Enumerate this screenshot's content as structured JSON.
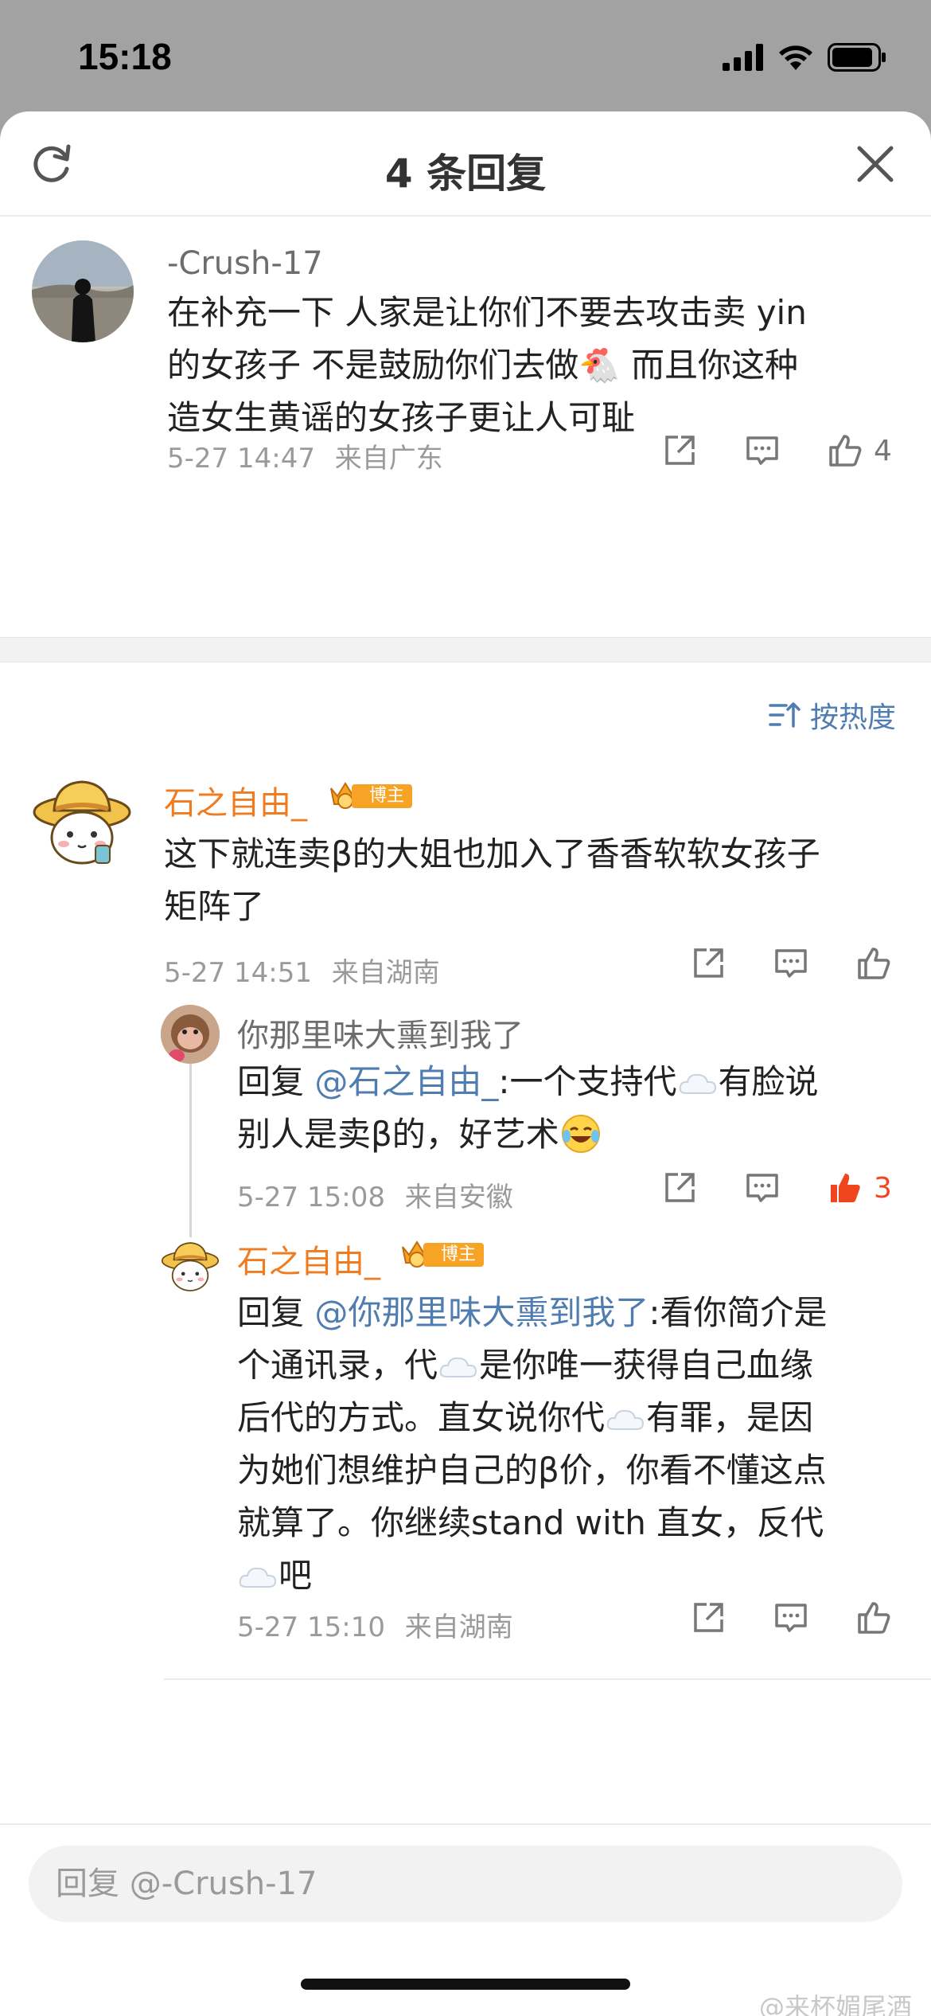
{
  "status_bar": {
    "time": "15:18"
  },
  "header": {
    "title": "4 条回复"
  },
  "root_comment": {
    "username": "-Crush-17",
    "text_line1": "在补充一下 人家是让你们不要去攻击卖 yin",
    "text_line2a": "的女孩子 不是鼓励你们去做",
    "text_line2b": " 而且你这种",
    "text_line3": "造女生黄谣的女孩子更让人可耻",
    "emoji": "🐔",
    "time": "5-27 14:47",
    "location": "来自广东",
    "likes": "4"
  },
  "sort": {
    "label": "按热度"
  },
  "reply1": {
    "username": "石之自由_",
    "badge": "博主",
    "text_line1": "这下就连卖β的大姐也加入了香香软软女孩子",
    "text_line2": "矩阵了",
    "time": "5-27 14:51",
    "location": "来自湖南"
  },
  "reply2": {
    "username": "你那里味大熏到我了",
    "prefix": "回复",
    "mention": "@石之自由_",
    "text_line1_rest": ":一个支持代",
    "text_line1_end": "有脸说",
    "text_line2": "别人是卖β的，好艺术",
    "time": "5-27 15:08",
    "location": "来自安徽",
    "likes": "3",
    "like_color": "#f0461f"
  },
  "reply3": {
    "username": "石之自由_",
    "badge": "博主",
    "prefix": "回复",
    "mention": "@你那里味大熏到我了",
    "text_line1_rest": ":看你简介是",
    "text_line2a": "个通讯录，代",
    "text_line2b": "是你唯一获得自己血缘",
    "text_line3a": "后代的方式。直女说你代",
    "text_line3b": "有罪，是因",
    "text_line4": "为她们想维护自己的β价，你看不懂这点",
    "text_line5": "就算了。你继续stand with 直女，反代",
    "text_line6": "吧",
    "time": "5-27 15:10",
    "location": "来自湖南"
  },
  "reply_bar": {
    "placeholder": "回复 @-Crush-17"
  },
  "watermark": "@来杯媚尾酒",
  "colors": {
    "accent_orange": "#f07c21",
    "link_blue": "#507daf",
    "like_red": "#f0461f"
  }
}
